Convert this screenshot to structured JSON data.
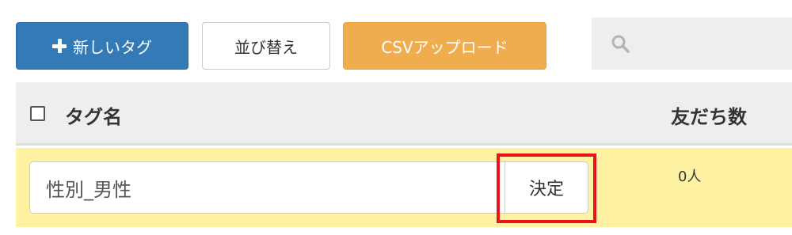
{
  "toolbar": {
    "new_tag_label": "新しいタグ",
    "sort_label": "並び替え",
    "csv_upload_label": "CSVアップロード"
  },
  "search": {
    "placeholder": "",
    "icon": "search-icon"
  },
  "table": {
    "header": {
      "tag_name": "タグ名",
      "friend_count": "友だち数"
    },
    "rows": [
      {
        "tag_name_value": "性別_男性",
        "decide_label": "決定",
        "friend_count": "0人"
      }
    ]
  },
  "colors": {
    "primary": "#337ab7",
    "warning": "#f0ad4e",
    "editing_row": "#fff3a3",
    "highlight": "#e8141b"
  }
}
